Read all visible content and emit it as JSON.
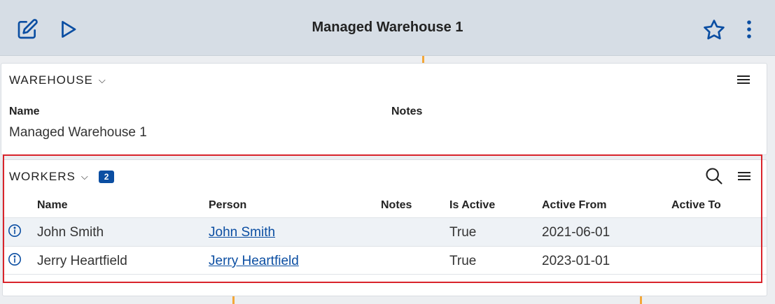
{
  "header": {
    "title": "Managed Warehouse 1"
  },
  "icons": {
    "edit": "edit-icon",
    "run": "play-icon",
    "favorite": "star-icon",
    "more": "more-vertical-icon"
  },
  "colors": {
    "accent": "#0b4ea2",
    "highlight": "#d9242b",
    "header_bg": "#d6dde5"
  },
  "warehouse": {
    "section_label": "WAREHOUSE",
    "fields": {
      "name_label": "Name",
      "name_value": "Managed Warehouse 1",
      "notes_label": "Notes",
      "notes_value": ""
    }
  },
  "workers": {
    "section_label": "WORKERS",
    "count": "2",
    "columns": {
      "name": "Name",
      "person": "Person",
      "notes": "Notes",
      "is_active": "Is Active",
      "active_from": "Active From",
      "active_to": "Active To"
    },
    "rows": [
      {
        "name": "John Smith",
        "person": "John Smith",
        "notes": "",
        "is_active": "True",
        "active_from": "2021-06-01",
        "active_to": ""
      },
      {
        "name": "Jerry Heartfield",
        "person": "Jerry Heartfield",
        "notes": "",
        "is_active": "True",
        "active_from": "2023-01-01",
        "active_to": ""
      }
    ]
  }
}
